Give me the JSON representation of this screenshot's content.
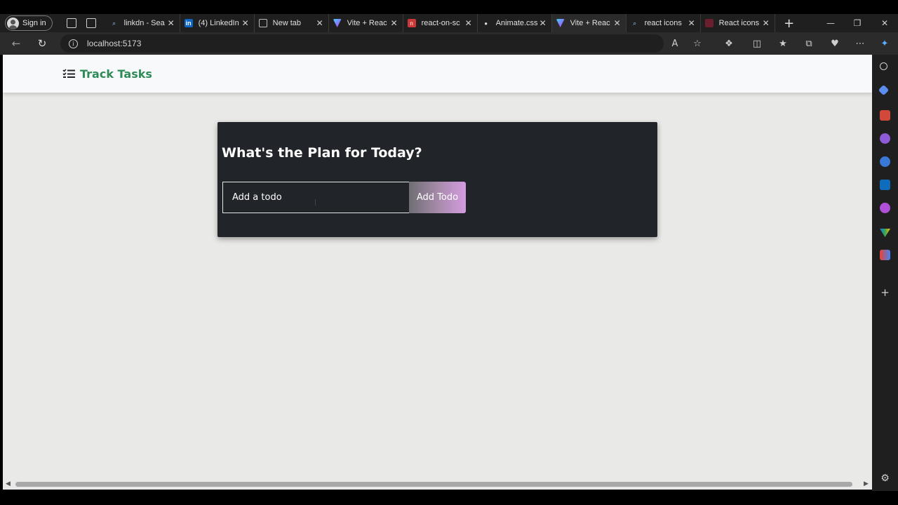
{
  "browser": {
    "signin_label": "Sign in",
    "tabs": [
      {
        "title": "linkdn - Sea",
        "favicon": "search-icon",
        "active": false
      },
      {
        "title": "(4) LinkedIn",
        "favicon": "linkedin-icon",
        "active": false
      },
      {
        "title": "New tab",
        "favicon": "newtab-icon",
        "active": false
      },
      {
        "title": "Vite + Reac",
        "favicon": "vite-icon",
        "active": false
      },
      {
        "title": "react-on-sc",
        "favicon": "npm-icon",
        "active": false
      },
      {
        "title": "Animate.css",
        "favicon": "animate-icon",
        "active": false
      },
      {
        "title": "Vite + Reac",
        "favicon": "vite-icon",
        "active": true
      },
      {
        "title": "react icons",
        "favicon": "search-icon",
        "active": false
      },
      {
        "title": "React icons",
        "favicon": "react-icons-icon",
        "active": false
      }
    ],
    "url": "localhost:5173"
  },
  "app": {
    "brand": "Track Tasks",
    "brand_color": "#2e8b57",
    "heading": "What's the Plan for Today?",
    "input_placeholder": "Add a todo",
    "input_value": "",
    "add_button_label": "Add Todo"
  }
}
